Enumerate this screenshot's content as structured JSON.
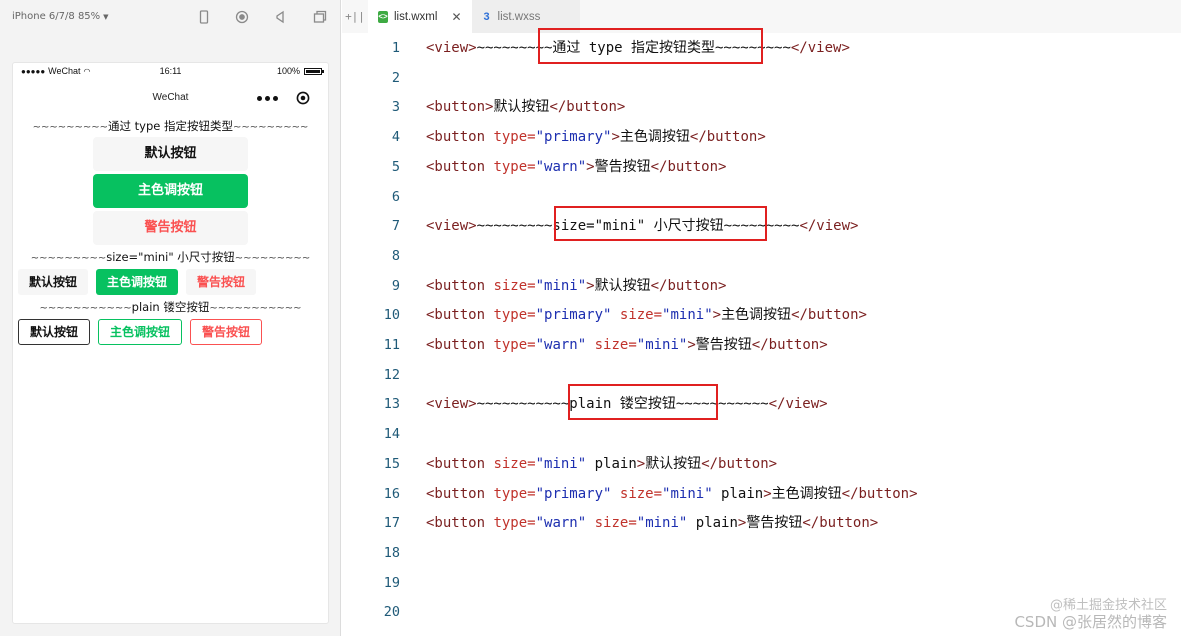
{
  "simulator": {
    "device_label": "iPhone 6/7/8 85%",
    "toolbar_icons": [
      "phone-icon",
      "record-icon",
      "volume-icon",
      "window-icon"
    ],
    "status_bar": {
      "carrier": "WeChat",
      "time": "16:11",
      "battery": "100%"
    },
    "nav_title": "WeChat",
    "sections": {
      "type_title": "通过 type 指定按钮类型",
      "size_title": "size=\"mini\" 小尺寸按钮",
      "plain_title": "plain 镂空按钮",
      "tilde_left_1": "~~~~~~~~~",
      "tilde_right_1": "~~~~~~~~~",
      "tilde_left_2": "~~~~~~~~~",
      "tilde_right_2": "~~~~~~~~~",
      "tilde_left_3": "~~~~~~~~~~~",
      "tilde_right_3": "~~~~~~~~~~~"
    },
    "buttons": {
      "default": "默认按钮",
      "primary": "主色调按钮",
      "warn": "警告按钮"
    }
  },
  "editor": {
    "split_label": "+||",
    "tabs": [
      {
        "label": "list.wxml",
        "active": true
      },
      {
        "label": "list.wxss",
        "active": false
      }
    ],
    "lines": [
      {
        "n": "1",
        "tokens": [
          [
            "tag",
            "<view>"
          ],
          [
            "txt",
            "~~~~~~~~~通过 type 指定按钮类型~~~~~~~~~"
          ],
          [
            "tag",
            "</view>"
          ]
        ]
      },
      {
        "n": "2",
        "tokens": []
      },
      {
        "n": "3",
        "tokens": [
          [
            "tag",
            "<button>"
          ],
          [
            "txt",
            "默认按钮"
          ],
          [
            "tag",
            "</button>"
          ]
        ]
      },
      {
        "n": "4",
        "tokens": [
          [
            "tag",
            "<button "
          ],
          [
            "attr",
            "type="
          ],
          [
            "val",
            "\"primary\""
          ],
          [
            "tag",
            ">"
          ],
          [
            "txt",
            "主色调按钮"
          ],
          [
            "tag",
            "</button>"
          ]
        ]
      },
      {
        "n": "5",
        "tokens": [
          [
            "tag",
            "<button "
          ],
          [
            "attr",
            "type="
          ],
          [
            "val",
            "\"warn\""
          ],
          [
            "tag",
            ">"
          ],
          [
            "txt",
            "警告按钮"
          ],
          [
            "tag",
            "</button>"
          ]
        ]
      },
      {
        "n": "6",
        "tokens": []
      },
      {
        "n": "7",
        "tokens": [
          [
            "tag",
            "<view>"
          ],
          [
            "txt",
            "~~~~~~~~~size=\"mini\" 小尺寸按钮~~~~~~~~~"
          ],
          [
            "tag",
            "</view>"
          ]
        ]
      },
      {
        "n": "8",
        "tokens": []
      },
      {
        "n": "9",
        "tokens": [
          [
            "tag",
            "<button "
          ],
          [
            "attr",
            "size="
          ],
          [
            "val",
            "\"mini\""
          ],
          [
            "tag",
            ">"
          ],
          [
            "txt",
            "默认按钮"
          ],
          [
            "tag",
            "</button>"
          ]
        ]
      },
      {
        "n": "10",
        "tokens": [
          [
            "tag",
            "<button "
          ],
          [
            "attr",
            "type="
          ],
          [
            "val",
            "\"primary\""
          ],
          [
            "txt",
            " "
          ],
          [
            "attr",
            "size="
          ],
          [
            "val",
            "\"mini\""
          ],
          [
            "tag",
            ">"
          ],
          [
            "txt",
            "主色调按钮"
          ],
          [
            "tag",
            "</button>"
          ]
        ]
      },
      {
        "n": "11",
        "tokens": [
          [
            "tag",
            "<button "
          ],
          [
            "attr",
            "type="
          ],
          [
            "val",
            "\"warn\""
          ],
          [
            "txt",
            " "
          ],
          [
            "attr",
            "size="
          ],
          [
            "val",
            "\"mini\""
          ],
          [
            "tag",
            ">"
          ],
          [
            "txt",
            "警告按钮"
          ],
          [
            "tag",
            "</button>"
          ]
        ]
      },
      {
        "n": "12",
        "tokens": []
      },
      {
        "n": "13",
        "tokens": [
          [
            "tag",
            "<view>"
          ],
          [
            "txt",
            "~~~~~~~~~~~plain 镂空按钮~~~~~~~~~~~"
          ],
          [
            "tag",
            "</view>"
          ]
        ]
      },
      {
        "n": "14",
        "tokens": []
      },
      {
        "n": "15",
        "tokens": [
          [
            "tag",
            "<button "
          ],
          [
            "attr",
            "size="
          ],
          [
            "val",
            "\"mini\""
          ],
          [
            "txt",
            " plain"
          ],
          [
            "tag",
            ">"
          ],
          [
            "txt",
            "默认按钮"
          ],
          [
            "tag",
            "</button>"
          ]
        ]
      },
      {
        "n": "16",
        "tokens": [
          [
            "tag",
            "<button "
          ],
          [
            "attr",
            "type="
          ],
          [
            "val",
            "\"primary\""
          ],
          [
            "txt",
            " "
          ],
          [
            "attr",
            "size="
          ],
          [
            "val",
            "\"mini\""
          ],
          [
            "txt",
            " plain"
          ],
          [
            "tag",
            ">"
          ],
          [
            "txt",
            "主色调按钮"
          ],
          [
            "tag",
            "</button>"
          ]
        ]
      },
      {
        "n": "17",
        "tokens": [
          [
            "tag",
            "<button "
          ],
          [
            "attr",
            "type="
          ],
          [
            "val",
            "\"warn\""
          ],
          [
            "txt",
            " "
          ],
          [
            "attr",
            "size="
          ],
          [
            "val",
            "\"mini\""
          ],
          [
            "txt",
            " plain"
          ],
          [
            "tag",
            ">"
          ],
          [
            "txt",
            "警告按钮"
          ],
          [
            "tag",
            "</button>"
          ]
        ]
      },
      {
        "n": "18",
        "tokens": []
      },
      {
        "n": "19",
        "tokens": []
      },
      {
        "n": "20",
        "tokens": []
      }
    ]
  },
  "watermark": {
    "top": "@稀土掘金技术社区",
    "bottom": "CSDN @张居然的博客"
  },
  "colors": {
    "primary_green": "#07c160",
    "warn_red": "#fa5151",
    "highlight_red": "#e02020"
  }
}
